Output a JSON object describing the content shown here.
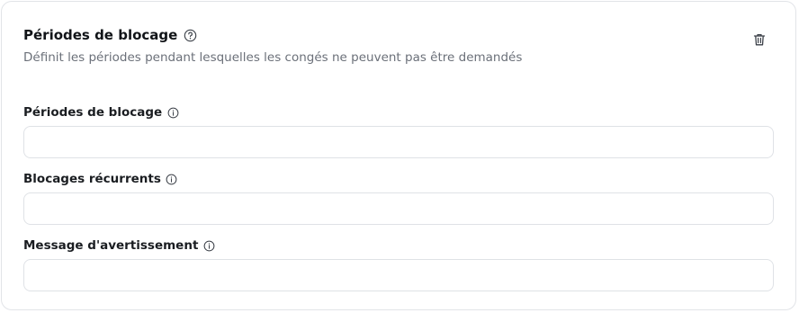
{
  "section": {
    "title": "Périodes de blocage",
    "description": "Définit les périodes pendant lesquelles les congés ne peuvent pas être demandés"
  },
  "fields": [
    {
      "label": "Périodes de blocage",
      "value": ""
    },
    {
      "label": "Blocages récurrents",
      "value": ""
    },
    {
      "label": "Message d'avertissement",
      "value": ""
    }
  ],
  "icons": {
    "help": "help-circle-icon",
    "info": "info-circle-icon",
    "delete": "trash-icon"
  },
  "colors": {
    "title": "#111418",
    "muted": "#6b7079",
    "border": "#dfe2e6"
  }
}
